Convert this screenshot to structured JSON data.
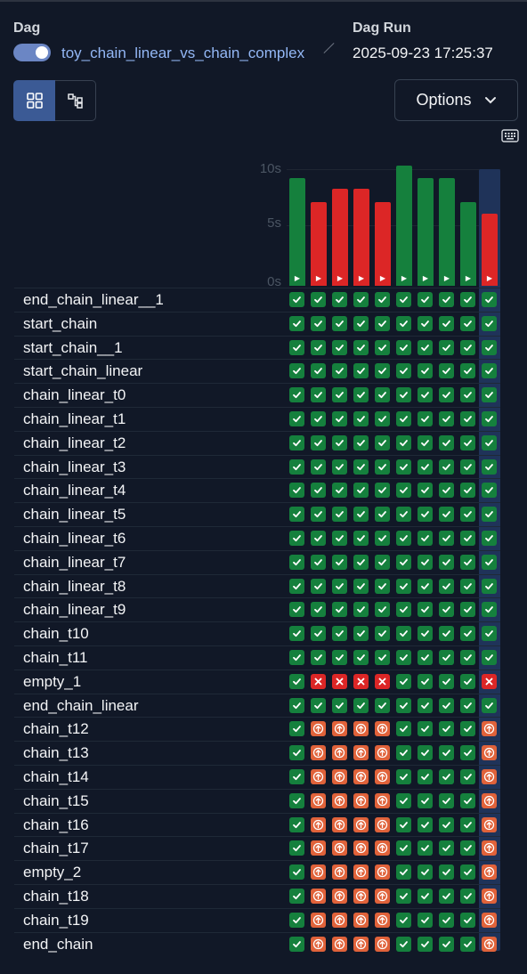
{
  "header": {
    "dag_label": "Dag",
    "dag_name": "toy_chain_linear_vs_chain_complex",
    "dag_run_label": "Dag Run",
    "dag_run_value": "2025-09-23 17:25:37",
    "toggle_on": true
  },
  "toolbar": {
    "grid_view": "grid-view-icon",
    "graph_view": "graph-view-icon",
    "options_label": "Options",
    "options_icon": "chevron-down-icon",
    "keyboard_icon": "keyboard-icon"
  },
  "chart": {
    "y_ticks": [
      "10s",
      "5s",
      "0s"
    ],
    "y_max_seconds": 10,
    "runs": [
      {
        "duration_seconds": 9.2,
        "state": "success"
      },
      {
        "duration_seconds": 7.2,
        "state": "failed"
      },
      {
        "duration_seconds": 8.3,
        "state": "failed"
      },
      {
        "duration_seconds": 8.3,
        "state": "failed"
      },
      {
        "duration_seconds": 7.2,
        "state": "failed"
      },
      {
        "duration_seconds": 10.3,
        "state": "success"
      },
      {
        "duration_seconds": 9.2,
        "state": "success"
      },
      {
        "duration_seconds": 9.2,
        "state": "success"
      },
      {
        "duration_seconds": 7.2,
        "state": "success"
      },
      {
        "duration_seconds": 6.2,
        "state": "failed",
        "selected": true
      }
    ]
  },
  "colors": {
    "success": "#15803d",
    "failed": "#dc2626",
    "upstream_failed": "#e0623a",
    "selected": "#1f3359"
  },
  "tasks": [
    {
      "name": "end_chain_linear__1",
      "states": [
        "s",
        "s",
        "s",
        "s",
        "s",
        "s",
        "s",
        "s",
        "s",
        "s"
      ]
    },
    {
      "name": "start_chain",
      "states": [
        "s",
        "s",
        "s",
        "s",
        "s",
        "s",
        "s",
        "s",
        "s",
        "s"
      ]
    },
    {
      "name": "start_chain__1",
      "states": [
        "s",
        "s",
        "s",
        "s",
        "s",
        "s",
        "s",
        "s",
        "s",
        "s"
      ]
    },
    {
      "name": "start_chain_linear",
      "states": [
        "s",
        "s",
        "s",
        "s",
        "s",
        "s",
        "s",
        "s",
        "s",
        "s"
      ]
    },
    {
      "name": "chain_linear_t0",
      "states": [
        "s",
        "s",
        "s",
        "s",
        "s",
        "s",
        "s",
        "s",
        "s",
        "s"
      ]
    },
    {
      "name": "chain_linear_t1",
      "states": [
        "s",
        "s",
        "s",
        "s",
        "s",
        "s",
        "s",
        "s",
        "s",
        "s"
      ]
    },
    {
      "name": "chain_linear_t2",
      "states": [
        "s",
        "s",
        "s",
        "s",
        "s",
        "s",
        "s",
        "s",
        "s",
        "s"
      ]
    },
    {
      "name": "chain_linear_t3",
      "states": [
        "s",
        "s",
        "s",
        "s",
        "s",
        "s",
        "s",
        "s",
        "s",
        "s"
      ]
    },
    {
      "name": "chain_linear_t4",
      "states": [
        "s",
        "s",
        "s",
        "s",
        "s",
        "s",
        "s",
        "s",
        "s",
        "s"
      ]
    },
    {
      "name": "chain_linear_t5",
      "states": [
        "s",
        "s",
        "s",
        "s",
        "s",
        "s",
        "s",
        "s",
        "s",
        "s"
      ]
    },
    {
      "name": "chain_linear_t6",
      "states": [
        "s",
        "s",
        "s",
        "s",
        "s",
        "s",
        "s",
        "s",
        "s",
        "s"
      ]
    },
    {
      "name": "chain_linear_t7",
      "states": [
        "s",
        "s",
        "s",
        "s",
        "s",
        "s",
        "s",
        "s",
        "s",
        "s"
      ]
    },
    {
      "name": "chain_linear_t8",
      "states": [
        "s",
        "s",
        "s",
        "s",
        "s",
        "s",
        "s",
        "s",
        "s",
        "s"
      ]
    },
    {
      "name": "chain_linear_t9",
      "states": [
        "s",
        "s",
        "s",
        "s",
        "s",
        "s",
        "s",
        "s",
        "s",
        "s"
      ]
    },
    {
      "name": "chain_t10",
      "states": [
        "s",
        "s",
        "s",
        "s",
        "s",
        "s",
        "s",
        "s",
        "s",
        "s"
      ]
    },
    {
      "name": "chain_t11",
      "states": [
        "s",
        "s",
        "s",
        "s",
        "s",
        "s",
        "s",
        "s",
        "s",
        "s"
      ]
    },
    {
      "name": "empty_1",
      "states": [
        "s",
        "f",
        "f",
        "f",
        "f",
        "s",
        "s",
        "s",
        "s",
        "f"
      ]
    },
    {
      "name": "end_chain_linear",
      "states": [
        "s",
        "s",
        "s",
        "s",
        "s",
        "s",
        "s",
        "s",
        "s",
        "s"
      ]
    },
    {
      "name": "chain_t12",
      "states": [
        "s",
        "u",
        "u",
        "u",
        "u",
        "s",
        "s",
        "s",
        "s",
        "u"
      ]
    },
    {
      "name": "chain_t13",
      "states": [
        "s",
        "u",
        "u",
        "u",
        "u",
        "s",
        "s",
        "s",
        "s",
        "u"
      ]
    },
    {
      "name": "chain_t14",
      "states": [
        "s",
        "u",
        "u",
        "u",
        "u",
        "s",
        "s",
        "s",
        "s",
        "u"
      ]
    },
    {
      "name": "chain_t15",
      "states": [
        "s",
        "u",
        "u",
        "u",
        "u",
        "s",
        "s",
        "s",
        "s",
        "u"
      ]
    },
    {
      "name": "chain_t16",
      "states": [
        "s",
        "u",
        "u",
        "u",
        "u",
        "s",
        "s",
        "s",
        "s",
        "u"
      ]
    },
    {
      "name": "chain_t17",
      "states": [
        "s",
        "u",
        "u",
        "u",
        "u",
        "s",
        "s",
        "s",
        "s",
        "u"
      ]
    },
    {
      "name": "empty_2",
      "states": [
        "s",
        "u",
        "u",
        "u",
        "u",
        "s",
        "s",
        "s",
        "s",
        "u"
      ]
    },
    {
      "name": "chain_t18",
      "states": [
        "s",
        "u",
        "u",
        "u",
        "u",
        "s",
        "s",
        "s",
        "s",
        "u"
      ]
    },
    {
      "name": "chain_t19",
      "states": [
        "s",
        "u",
        "u",
        "u",
        "u",
        "s",
        "s",
        "s",
        "s",
        "u"
      ]
    },
    {
      "name": "end_chain",
      "states": [
        "s",
        "u",
        "u",
        "u",
        "u",
        "s",
        "s",
        "s",
        "s",
        "u"
      ]
    }
  ]
}
